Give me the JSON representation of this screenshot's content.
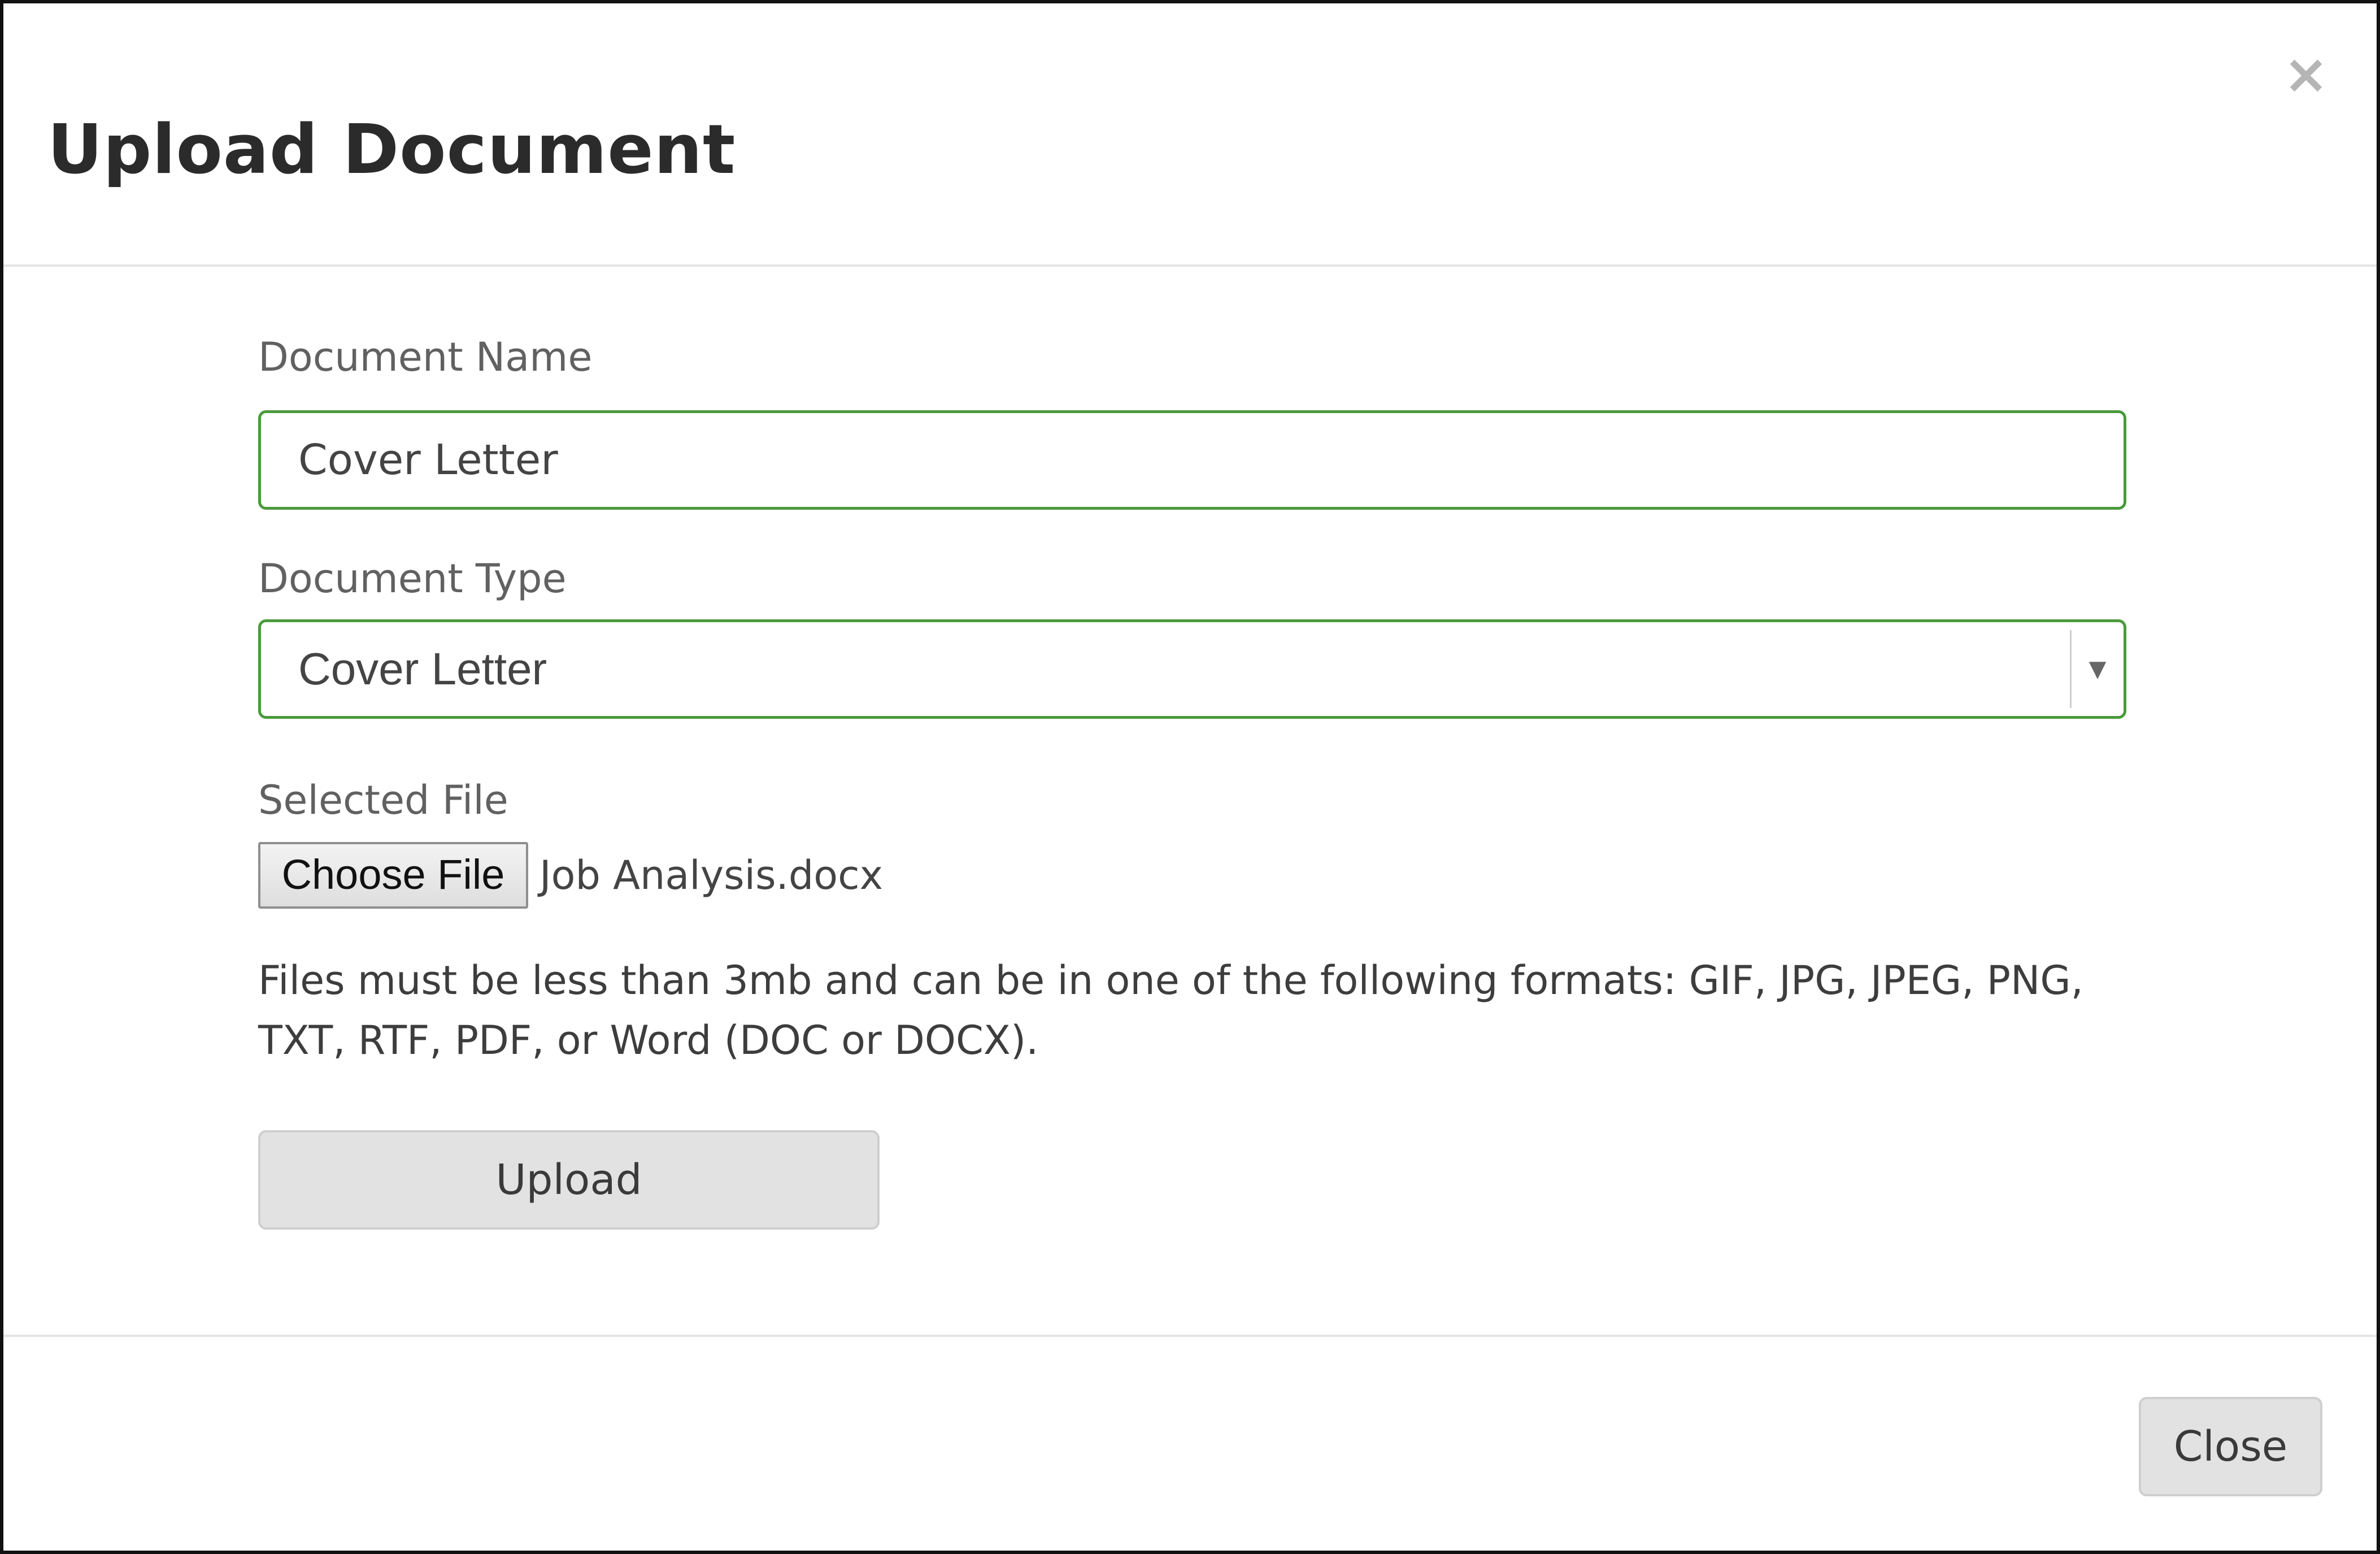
{
  "modal": {
    "title": "Upload Document",
    "close_icon": "×"
  },
  "form": {
    "document_name": {
      "label": "Document Name",
      "value": "Cover Letter"
    },
    "document_type": {
      "label": "Document Type",
      "value": "Cover Letter",
      "arrow": "▼"
    },
    "selected_file": {
      "label": "Selected File",
      "button_label": "Choose File",
      "file_name": "Job Analysis.docx"
    },
    "help_text": "Files must be less than 3mb and can be in one of the following formats: GIF, JPG, JPEG, PNG, TXT, RTF, PDF, or Word (DOC or DOCX).",
    "upload_label": "Upload"
  },
  "footer": {
    "close_label": "Close"
  },
  "colors": {
    "input_border": "#4a9a3c",
    "button_bg": "#e2e2e2",
    "divider": "#e5e5e5"
  },
  "icons": {
    "close": "close-icon",
    "dropdown": "chevron-down-icon"
  }
}
